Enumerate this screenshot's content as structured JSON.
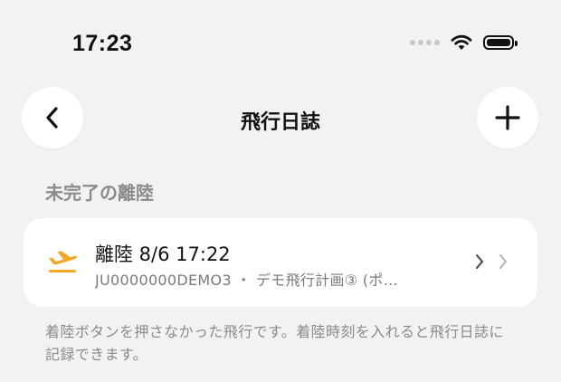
{
  "status_bar": {
    "time": "17:23"
  },
  "nav": {
    "title": "飛行日誌"
  },
  "section": {
    "title": "未完了の離陸"
  },
  "item": {
    "title": "離陸 8/6 17:22",
    "subtitle": "JU0000000DEMO3 ・ デモ飛行計画③ (ポ…"
  },
  "footnote": "着陸ボタンを押さなかった飛行です。着陸時刻を入れると飛行日誌に記録できます。",
  "colors": {
    "accent": "#f5a623",
    "background": "#f2f2f2",
    "card": "#ffffff",
    "secondary_text": "#8a8a8f"
  },
  "icons": {
    "back": "chevron-left-icon",
    "add": "plus-icon",
    "takeoff": "airplane-takeoff-icon",
    "disclosure": "chevron-right-icon"
  }
}
